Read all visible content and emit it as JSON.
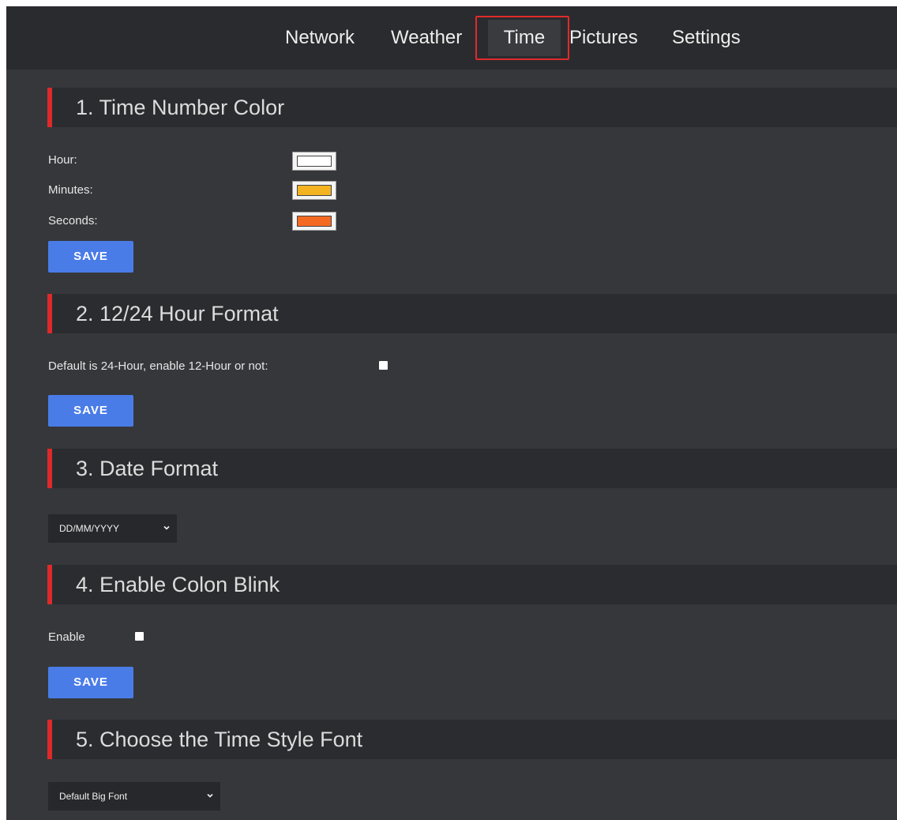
{
  "nav": {
    "tabs": [
      {
        "label": "Network"
      },
      {
        "label": "Weather"
      },
      {
        "label": "Time",
        "active": true
      },
      {
        "label": "Pictures"
      },
      {
        "label": "Settings"
      }
    ],
    "highlight_color": "#e02a2a"
  },
  "sections": {
    "time_number_color": {
      "title": "1. Time Number Color",
      "hour_label": "Hour:",
      "minutes_label": "Minutes:",
      "seconds_label": "Seconds:",
      "hour_color": "#ffffff",
      "minutes_color": "#f4b320",
      "seconds_color": "#f56a22",
      "save_label": "SAVE"
    },
    "hour_format": {
      "title": "2. 12/24 Hour Format",
      "label": "Default is 24-Hour, enable 12-Hour or not:",
      "checked": false,
      "save_label": "SAVE"
    },
    "date_format": {
      "title": "3. Date Format",
      "selected": "DD/MM/YYYY"
    },
    "colon_blink": {
      "title": "4. Enable Colon Blink",
      "label": "Enable",
      "checked": false,
      "save_label": "SAVE"
    },
    "time_style_font": {
      "title": "5. Choose the Time Style Font",
      "selected": "Default Big Font"
    }
  },
  "colors": {
    "accent_bar": "#dd2a2a",
    "save_button": "#4a7ce8",
    "background": "#36373b",
    "header_background": "#2b2c2f"
  },
  "icons": {
    "select_chevron": "chevron-down-icon"
  }
}
